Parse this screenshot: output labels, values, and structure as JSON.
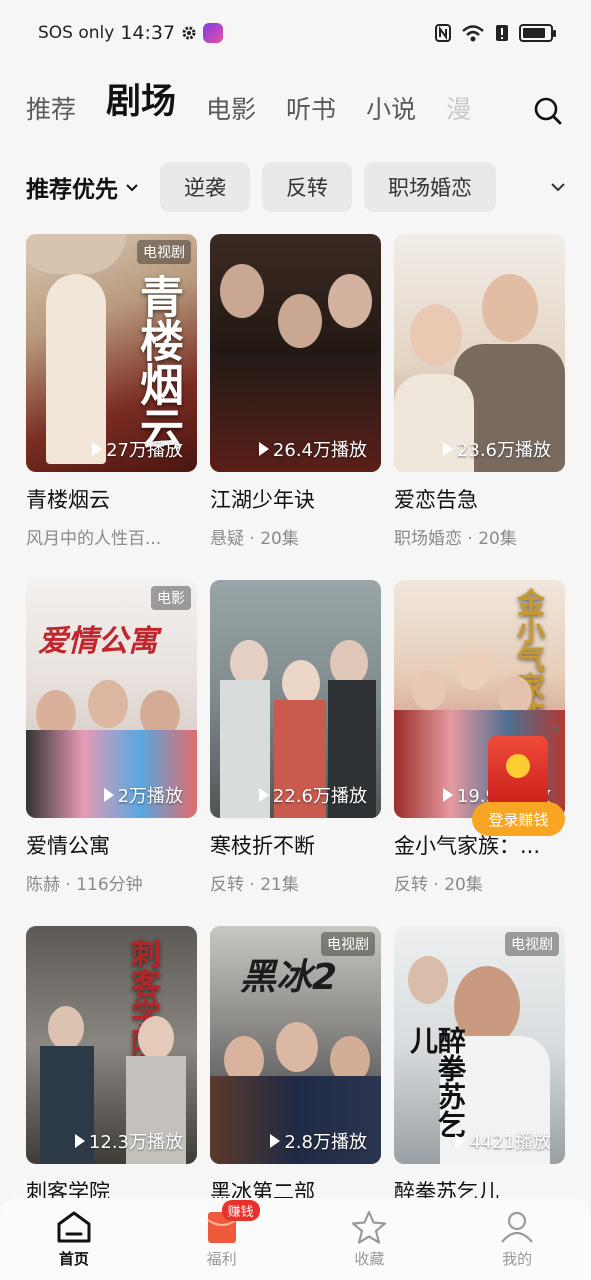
{
  "status_bar": {
    "carrier": "SOS only",
    "time": "14:37"
  },
  "top_tabs": [
    "推荐",
    "剧场",
    "电影",
    "听书",
    "小说",
    "漫"
  ],
  "active_tab": 1,
  "filter": {
    "sort_label": "推荐优先",
    "chips": [
      "逆袭",
      "反转",
      "职场婚恋"
    ]
  },
  "cards": [
    {
      "title": "青楼烟云",
      "sub": "风月中的人性百...",
      "plays": "27万播放",
      "badge": "电视剧",
      "art": "青楼烟云"
    },
    {
      "title": "江湖少年诀",
      "sub": "悬疑 · 20集",
      "plays": "26.4万播放",
      "badge": "",
      "art": ""
    },
    {
      "title": "爱恋告急",
      "sub": "职场婚恋 · 20集",
      "plays": "23.6万播放",
      "badge": "",
      "art": ""
    },
    {
      "title": "爱情公寓",
      "sub": "陈赫 · 116分钟",
      "plays": "2万播放",
      "badge": "电影",
      "art": "爱情公寓"
    },
    {
      "title": "寒枝折不断",
      "sub": "反转 · 21集",
      "plays": "22.6万播放",
      "badge": "",
      "art": ""
    },
    {
      "title": "金小气家族：...",
      "sub": "反转 · 20集",
      "plays": "19.9万播放",
      "badge": "",
      "art": "金小气家族"
    },
    {
      "title": "刺客学院",
      "sub": "",
      "plays": "12.3万播放",
      "badge": "",
      "art": "刺客学院"
    },
    {
      "title": "黑冰第二部",
      "sub": "",
      "plays": "2.8万播放",
      "badge": "电视剧",
      "art": "黑冰2"
    },
    {
      "title": "醉拳苏乞儿",
      "sub": "",
      "plays": "4421播放",
      "badge": "电视剧",
      "art": "醉拳苏乞儿"
    }
  ],
  "promo": {
    "label": "登录赚钱"
  },
  "bottom_nav": {
    "items": [
      "首页",
      "福利",
      "收藏",
      "我的"
    ],
    "badge": "赚钱"
  }
}
